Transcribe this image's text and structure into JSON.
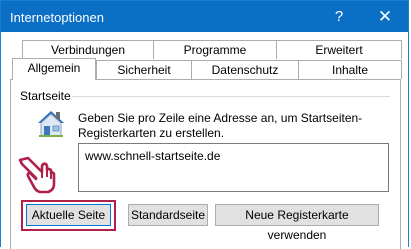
{
  "window": {
    "title": "Internetoptionen",
    "help_glyph": "?",
    "close_glyph": "✕",
    "accent_color": "#0b6fc6"
  },
  "tabs": {
    "row1": [
      "Verbindungen",
      "Programme",
      "Erweitert"
    ],
    "row2": [
      "Allgemein",
      "Sicherheit",
      "Datenschutz",
      "Inhalte"
    ],
    "active": "Allgemein"
  },
  "startseite": {
    "heading": "Startseite",
    "description": "Geben Sie pro Zeile eine Adresse an, um Startseiten-Registerkarten zu erstellen.",
    "url_value": "www.schnell-startseite.de",
    "icons": [
      "house-icon",
      "pointing-hand-icon"
    ],
    "highlight_color": "#b0204a"
  },
  "buttons": {
    "current": "Aktuelle Seite",
    "standard": "Standardseite",
    "new_tab": "Neue Registerkarte verwenden"
  }
}
